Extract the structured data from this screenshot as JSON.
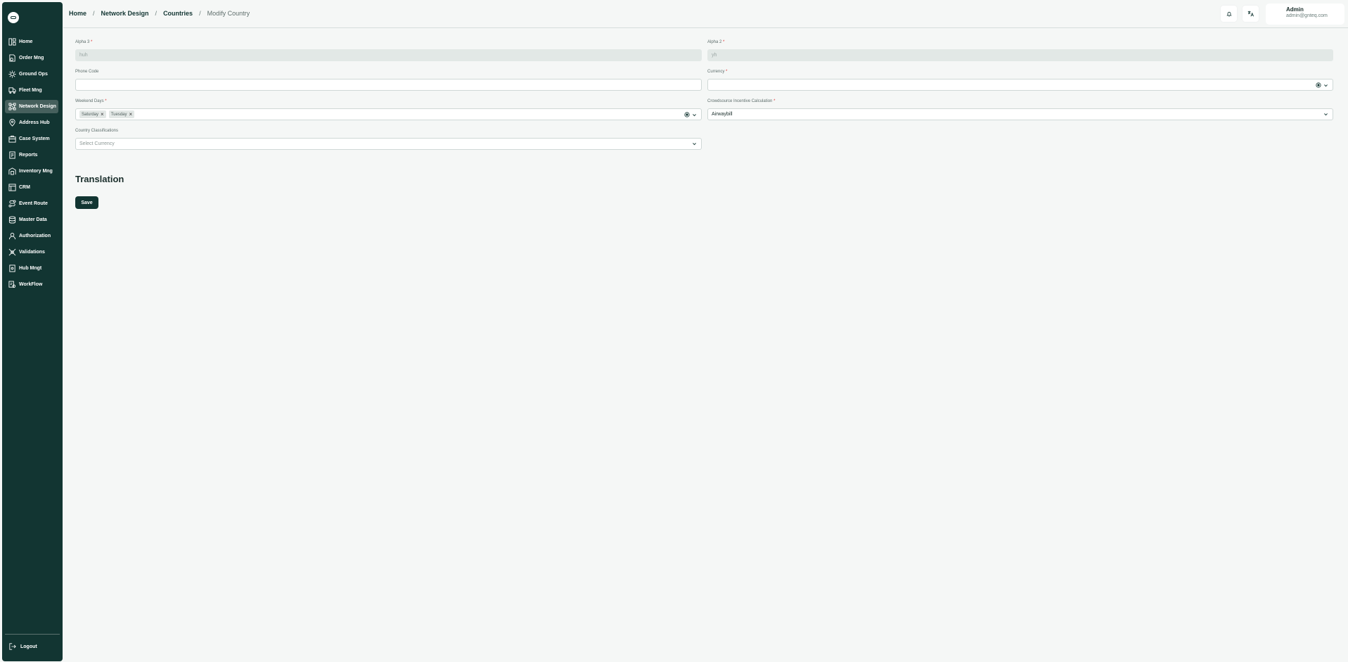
{
  "sidebar": {
    "items": [
      {
        "label": "Home",
        "icon": "dashboard-icon"
      },
      {
        "label": "Order Mng",
        "icon": "order-icon"
      },
      {
        "label": "Ground Ops",
        "icon": "ground-ops-icon"
      },
      {
        "label": "Fleet Mng",
        "icon": "truck-icon"
      },
      {
        "label": "Network Design",
        "icon": "network-icon"
      },
      {
        "label": "Address Hub",
        "icon": "location-icon"
      },
      {
        "label": "Case System",
        "icon": "case-icon"
      },
      {
        "label": "Reports",
        "icon": "report-icon"
      },
      {
        "label": "Inventory Mng",
        "icon": "inventory-icon"
      },
      {
        "label": "CRM",
        "icon": "crm-icon"
      },
      {
        "label": "Event Route",
        "icon": "route-icon"
      },
      {
        "label": "Master Data",
        "icon": "database-icon"
      },
      {
        "label": "Authorization",
        "icon": "user-icon"
      },
      {
        "label": "Validations",
        "icon": "validation-icon"
      },
      {
        "label": "Hub Mngt",
        "icon": "hub-icon"
      },
      {
        "label": "WorkFlow",
        "icon": "workflow-icon"
      }
    ],
    "active_index": 4,
    "logout_label": "Logout"
  },
  "header": {
    "breadcrumb": [
      "Home",
      "Network Design",
      "Countries"
    ],
    "current": "Modify Country",
    "separator": "/",
    "user_name": "Admin",
    "user_email": "admin@gnteq.com"
  },
  "form": {
    "alpha3": {
      "label": "Alpha 3",
      "value": "huh"
    },
    "alpha2": {
      "label": "Alpha 2",
      "value": "yh"
    },
    "phone_code": {
      "label": "Phone Code",
      "value": ""
    },
    "currency": {
      "label": "Currency",
      "value": ""
    },
    "weekend_days": {
      "label": "Weekend Days",
      "chips": [
        "Saturday",
        "Tuesday"
      ]
    },
    "crowdsource": {
      "label": "Crowdsource Incentive Calculation",
      "value": "Airwaybill"
    },
    "classifications": {
      "label": "Country Classifications",
      "placeholder": "Select Currency"
    },
    "required_mark": "*"
  },
  "translation_title": "Translation",
  "save_label": "Save",
  "colors": {
    "sidebar_bg": "#123532",
    "active_bg": "#46605d",
    "page_bg": "#f5f7f6",
    "required": "#dd3333"
  }
}
